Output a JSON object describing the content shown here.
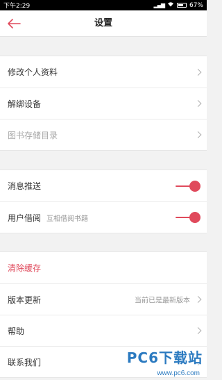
{
  "status_bar": {
    "time": "下午2:29",
    "signal": "▂▄▆",
    "battery_percent": "67%"
  },
  "header": {
    "title": "设置"
  },
  "group1": {
    "items": [
      {
        "label": "修改个人资料"
      },
      {
        "label": "解绑设备"
      },
      {
        "label": "图书存储目录"
      }
    ]
  },
  "group2": {
    "items": [
      {
        "label": "消息推送",
        "toggle_on": true
      },
      {
        "label": "用户借阅",
        "sub_label": "互相借阅书籍",
        "toggle_on": true
      }
    ]
  },
  "group3": {
    "items": [
      {
        "label": "清除缓存"
      },
      {
        "label": "版本更新",
        "value": "当前已是最新版本"
      },
      {
        "label": "帮助"
      },
      {
        "label": "联系我们"
      }
    ]
  },
  "watermark": {
    "title": "PC6下载站",
    "url": "www.pc6.com"
  },
  "colors": {
    "accent": "#e04a5c",
    "background": "#f2f2f2"
  }
}
